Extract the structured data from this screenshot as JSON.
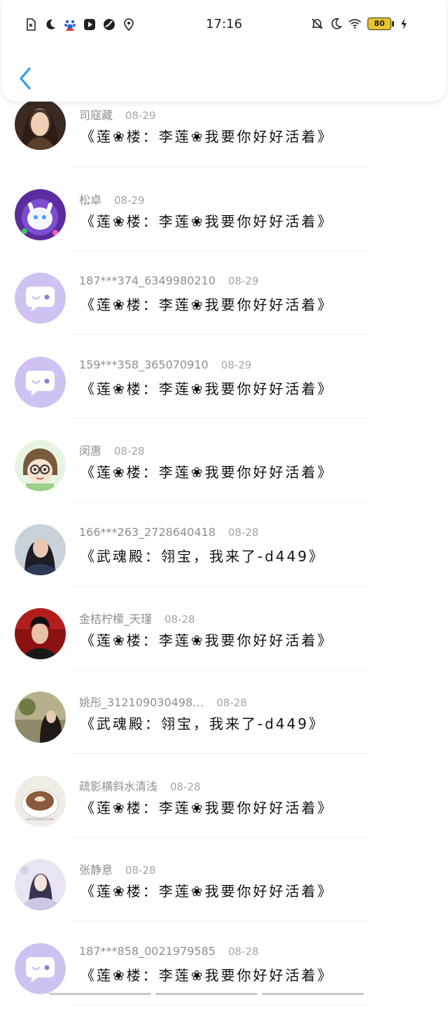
{
  "status_bar": {
    "time": "17:16",
    "battery": "80"
  },
  "header": {
    "back_icon": "chevron-left-icon"
  },
  "colors": {
    "accent": "#2f9bf2",
    "chat_avatar_bg": "#cfc2f2",
    "chat_avatar_fg": "#ffffff"
  },
  "items": [
    {
      "name": "司寇藏",
      "date": "08-29",
      "message": "《莲❀楼：李莲❀我要你好好活着》",
      "avatar": "photo-woman"
    },
    {
      "name": "松卓",
      "date": "08-29",
      "message": "《莲❀楼：李莲❀我要你好好活着》",
      "avatar": "cat-illustration"
    },
    {
      "name": "187***374_6349980210",
      "date": "08-29",
      "message": "《莲❀楼：李莲❀我要你好好活着》",
      "avatar": "default-chat"
    },
    {
      "name": "159***358_365070910",
      "date": "08-29",
      "message": "《莲❀楼：李莲❀我要你好好活着》",
      "avatar": "default-chat"
    },
    {
      "name": "闵惠",
      "date": "08-28",
      "message": "《莲❀楼：李莲❀我要你好好活着》",
      "avatar": "cartoon-girl"
    },
    {
      "name": "166***263_2728640418",
      "date": "08-28",
      "message": "《武魂殿：翎宝，我来了-d449》",
      "avatar": "photo-girl"
    },
    {
      "name": "金桔柠檬_天瑾",
      "date": "08-28",
      "message": "《莲❀楼：李莲❀我要你好好活着》",
      "avatar": "photo-red"
    },
    {
      "name": "姚彤_312109030498…",
      "date": "08-28",
      "message": "《武魂殿：翎宝，我来了-d449》",
      "avatar": "photo-outdoor"
    },
    {
      "name": "疏影横斜水清浅",
      "date": "08-28",
      "message": "《莲❀楼：李莲❀我要你好好活着》",
      "avatar": "coffee-cup"
    },
    {
      "name": "张静意",
      "date": "08-28",
      "message": "《莲❀楼：李莲❀我要你好好活着》",
      "avatar": "illustration-girl"
    },
    {
      "name": "187***858_0021979585",
      "date": "08-28",
      "message": "《莲❀楼：李莲❀我要你好好活着》",
      "avatar": "default-chat"
    }
  ]
}
